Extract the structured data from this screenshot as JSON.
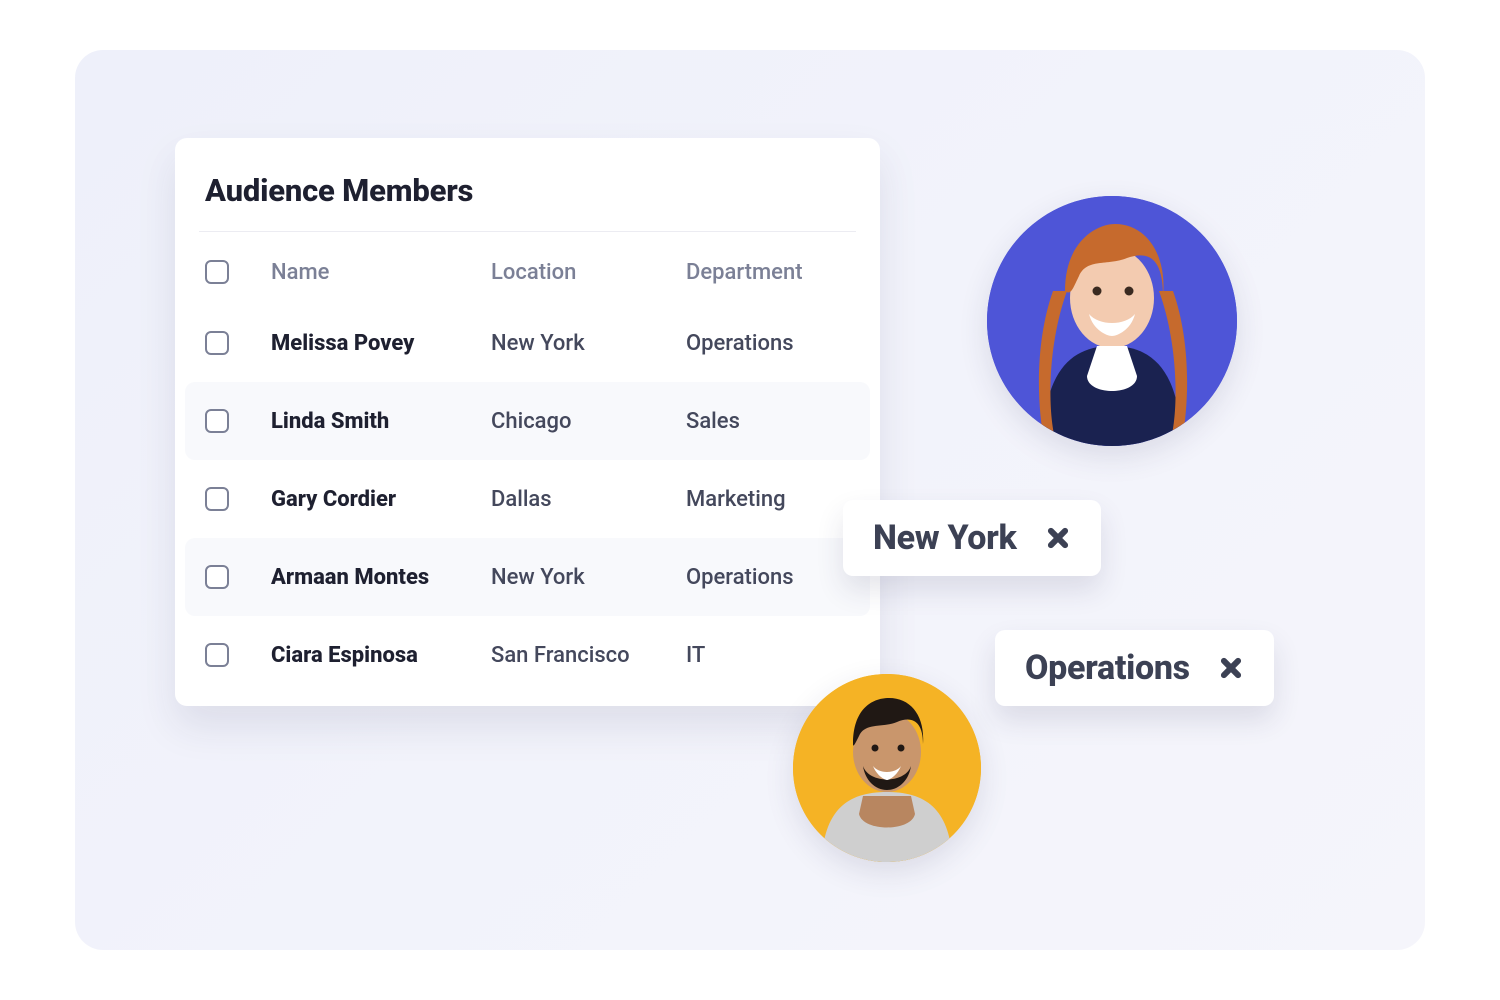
{
  "card": {
    "title": "Audience Members",
    "columns": [
      "Name",
      "Location",
      "Department"
    ],
    "rows": [
      {
        "name": "Melissa Povey",
        "location": "New York",
        "department": "Operations"
      },
      {
        "name": "Linda Smith",
        "location": "Chicago",
        "department": "Sales"
      },
      {
        "name": "Gary Cordier",
        "location": "Dallas",
        "department": "Marketing"
      },
      {
        "name": "Armaan Montes",
        "location": "New York",
        "department": "Operations"
      },
      {
        "name": "Ciara Espinosa",
        "location": "San Francisco",
        "department": "IT"
      }
    ]
  },
  "chips": [
    {
      "label": "New York"
    },
    {
      "label": "Operations"
    }
  ]
}
